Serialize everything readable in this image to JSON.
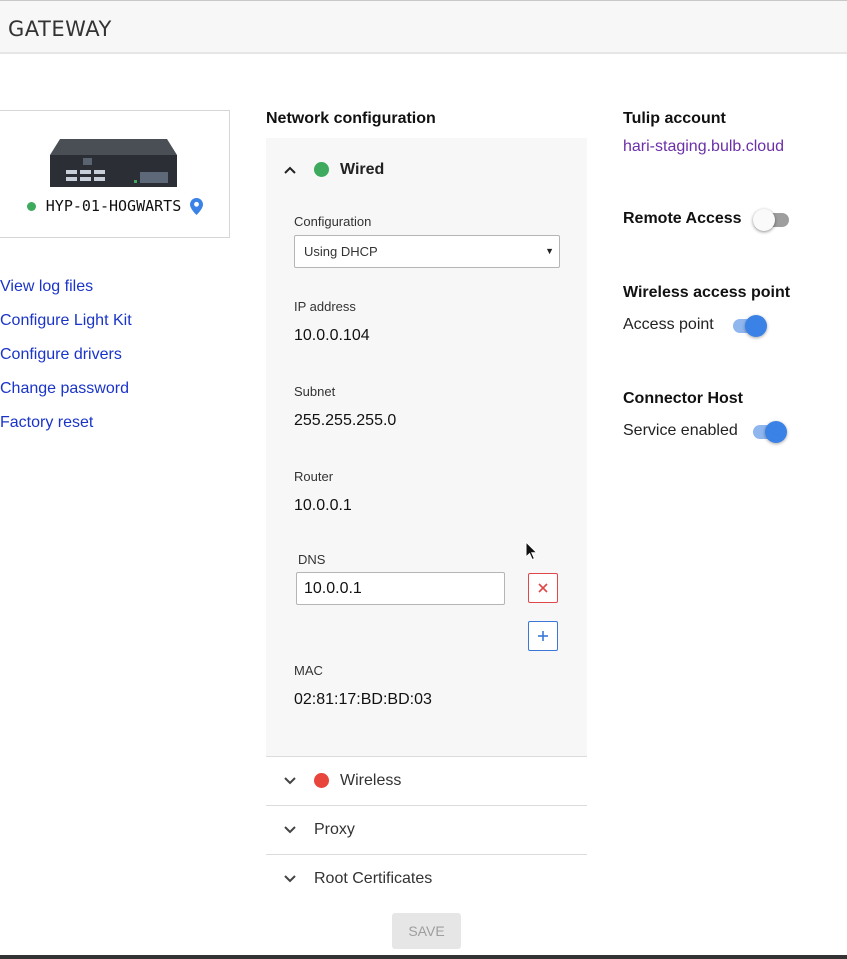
{
  "header": {
    "title": "GATEWAY"
  },
  "device": {
    "name": "HYP-01-HOGWARTS",
    "status_color": "#3daa5e"
  },
  "links": [
    "View log files",
    "Configure Light Kit",
    "Configure drivers",
    "Change password",
    "Factory reset"
  ],
  "network": {
    "title": "Network configuration",
    "wired": {
      "label": "Wired",
      "status_color": "#3daa5e",
      "expanded": true,
      "configuration_label": "Configuration",
      "configuration_value": "Using DHCP",
      "ip_label": "IP address",
      "ip_value": "10.0.0.104",
      "subnet_label": "Subnet",
      "subnet_value": "255.255.255.0",
      "router_label": "Router",
      "router_value": "10.0.0.1",
      "dns_label": "DNS",
      "dns_value": "10.0.0.1",
      "mac_label": "MAC",
      "mac_value": "02:81:17:BD:BD:03"
    },
    "wireless": {
      "label": "Wireless",
      "status_color": "#e8453c"
    },
    "proxy": {
      "label": "Proxy"
    },
    "root_certificates": {
      "label": "Root Certificates"
    },
    "save_label": "SAVE"
  },
  "tulip_account": {
    "title": "Tulip account",
    "link": "hari-staging.bulb.cloud"
  },
  "remote_access": {
    "title": "Remote Access",
    "enabled": false
  },
  "wireless_ap": {
    "title": "Wireless access point",
    "toggle_label": "Access point",
    "enabled": true
  },
  "connector_host": {
    "title": "Connector Host",
    "toggle_label": "Service enabled",
    "enabled": true
  },
  "colors": {
    "link": "#1a34c9",
    "account_link": "#6b2fa8",
    "toggle_on": "#3b82e6",
    "remove": "#e04848",
    "add": "#3a77d8"
  },
  "icons": {
    "location": "map-pin-icon",
    "expand": "chevron-icon",
    "remove": "close-icon",
    "add": "plus-icon"
  }
}
